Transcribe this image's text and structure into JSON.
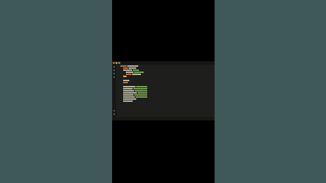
{
  "layout_colors": {
    "side_panel": "#3f5858",
    "frame": "#000000",
    "editor_bg": "#1e1f1c",
    "keyword": "#c96c3d",
    "string": "#7aa05a",
    "identifier": "#b9b9a6",
    "accent": "#d4b85a"
  },
  "ide": {
    "window_controls": [
      {
        "name": "close",
        "color": "#e0554c"
      },
      {
        "name": "minimize",
        "color": "#d9a63a"
      },
      {
        "name": "maximize",
        "color": "#4fb346"
      }
    ],
    "menu_bar": [
      "",
      "",
      "",
      "",
      "",
      "",
      ""
    ],
    "window_title": "",
    "editor_lines": [
      {
        "indent": 0,
        "segments": [
          {
            "w": 10,
            "c": "#c96c3d"
          },
          {
            "w": 18,
            "c": "#b9b9a6"
          }
        ]
      },
      {
        "indent": 2,
        "segments": [
          {
            "w": 8,
            "c": "#c96c3d"
          },
          {
            "w": 12,
            "c": "#b9b9a6"
          }
        ]
      },
      {
        "indent": 2,
        "segments": [
          {
            "w": 14,
            "c": "#b9b9a6"
          },
          {
            "w": 10,
            "c": "#7aa05a"
          }
        ]
      },
      {
        "indent": 4,
        "segments": [
          {
            "w": 12,
            "c": "#b9b9a6"
          },
          {
            "w": 16,
            "c": "#7aa05a"
          }
        ]
      },
      {
        "indent": 4,
        "segments": [
          {
            "w": 9,
            "c": "#c96c3d"
          },
          {
            "w": 14,
            "c": "#b9b9a6"
          }
        ]
      },
      {
        "indent": 2,
        "segments": [
          {
            "w": 6,
            "c": "#b9b9a6"
          }
        ]
      },
      {
        "indent": 0,
        "segments": []
      },
      {
        "indent": 2,
        "segments": [
          {
            "w": 10,
            "c": "#b9b9a6"
          }
        ]
      },
      {
        "indent": 2,
        "segments": [
          {
            "w": 8,
            "c": "#c96c3d"
          }
        ]
      },
      {
        "indent": 0,
        "segments": []
      },
      {
        "indent": 2,
        "segments": [
          {
            "w": 20,
            "c": "#b9b9a6"
          },
          {
            "w": 18,
            "c": "#7aa05a"
          }
        ]
      },
      {
        "indent": 2,
        "segments": [
          {
            "w": 16,
            "c": "#b9b9a6"
          },
          {
            "w": 22,
            "c": "#7aa05a"
          }
        ]
      },
      {
        "indent": 2,
        "segments": [
          {
            "w": 18,
            "c": "#b9b9a6"
          },
          {
            "w": 20,
            "c": "#7aa05a"
          }
        ]
      },
      {
        "indent": 2,
        "segments": [
          {
            "w": 22,
            "c": "#b9b9a6"
          },
          {
            "w": 16,
            "c": "#7aa05a"
          }
        ]
      },
      {
        "indent": 2,
        "segments": [
          {
            "w": 17,
            "c": "#b9b9a6"
          },
          {
            "w": 21,
            "c": "#7aa05a"
          }
        ]
      },
      {
        "indent": 2,
        "segments": [
          {
            "w": 19,
            "c": "#b9b9a6"
          },
          {
            "w": 19,
            "c": "#7aa05a"
          }
        ]
      },
      {
        "indent": 2,
        "segments": [
          {
            "w": 21,
            "c": "#b9b9a6"
          }
        ]
      },
      {
        "indent": 2,
        "segments": [
          {
            "w": 15,
            "c": "#b9b9a6"
          }
        ]
      }
    ],
    "status_left": "",
    "status_right": ""
  }
}
